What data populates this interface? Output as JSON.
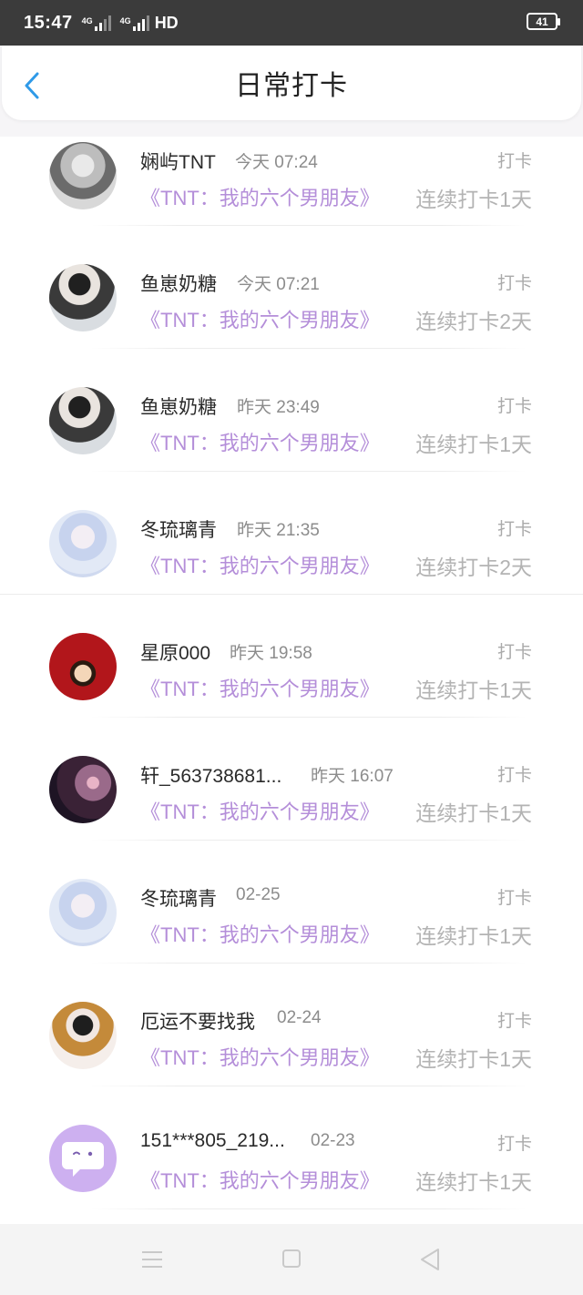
{
  "status_bar": {
    "time": "15:47",
    "signal1_label": "4G",
    "signal2_label": "4G",
    "hd_label": "HD",
    "battery": "41"
  },
  "header": {
    "title": "日常打卡",
    "back_icon": "chevron-left-icon"
  },
  "colors": {
    "accent_blue": "#2f9ae8",
    "book_purple": "#b48ed9",
    "avatar_purple": "#cdb0f0"
  },
  "checkins": [
    {
      "name": "娴屿TNT",
      "time": "今天 07:24",
      "punch": "打卡",
      "book": "《TNT：我的六个男朋友》",
      "streak": "连续打卡1天"
    },
    {
      "name": "鱼崽奶糖",
      "time": "今天 07:21",
      "punch": "打卡",
      "book": "《TNT：我的六个男朋友》",
      "streak": "连续打卡2天"
    },
    {
      "name": "鱼崽奶糖",
      "time": "昨天 23:49",
      "punch": "打卡",
      "book": "《TNT：我的六个男朋友》",
      "streak": "连续打卡1天"
    },
    {
      "name": "冬琉璃青",
      "time": "昨天 21:35",
      "punch": "打卡",
      "book": "《TNT：我的六个男朋友》",
      "streak": "连续打卡2天"
    },
    {
      "name": "星原000",
      "time": "昨天 19:58",
      "punch": "打卡",
      "book": "《TNT：我的六个男朋友》",
      "streak": "连续打卡1天"
    },
    {
      "name": "轩_563738681...",
      "time": "昨天 16:07",
      "punch": "打卡",
      "book": "《TNT：我的六个男朋友》",
      "streak": "连续打卡1天"
    },
    {
      "name": "冬琉璃青",
      "time": "02-25",
      "punch": "打卡",
      "book": "《TNT：我的六个男朋友》",
      "streak": "连续打卡1天"
    },
    {
      "name": "厄运不要找我",
      "time": "02-24",
      "punch": "打卡",
      "book": "《TNT：我的六个男朋友》",
      "streak": "连续打卡1天"
    },
    {
      "name": "151***805_219...",
      "time": "02-23",
      "punch": "打卡",
      "book": "《TNT：我的六个男朋友》",
      "streak": "连续打卡1天"
    }
  ],
  "nav_bar": {
    "menu_icon": "menu-icon",
    "home_icon": "home-square-icon",
    "back_icon": "back-triangle-icon"
  }
}
